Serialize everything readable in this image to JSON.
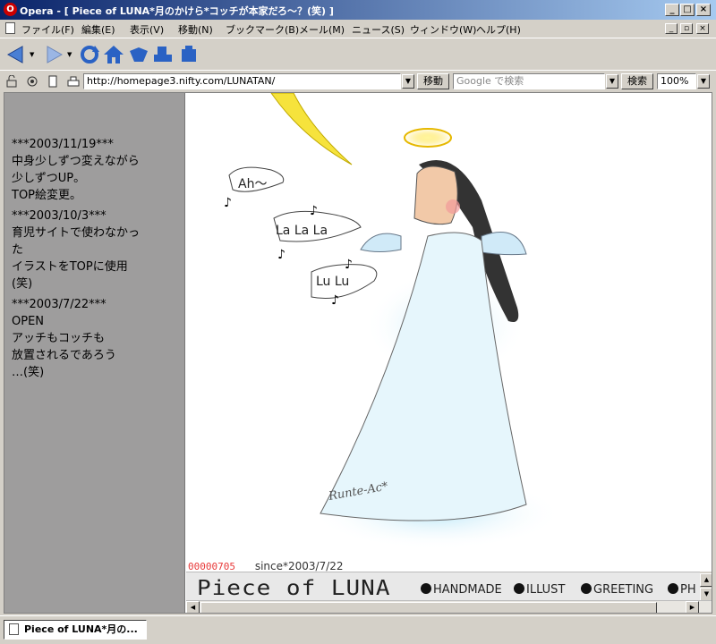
{
  "window": {
    "title": "Opera - [ Piece of LUNA*月のかけら*コッチが本家だろ～？(笑) ]",
    "controls": [
      "_",
      "□",
      "×"
    ]
  },
  "menubar": {
    "items": [
      "ファイル(F)",
      "編集(E)",
      "表示(V)",
      "移動(N)",
      "ブックマーク(B)",
      "メール(M)",
      "ニュース(S)",
      "ウィンドウ(W)",
      "ヘルプ(H)"
    ],
    "mdi_controls": [
      "_",
      "▫",
      "×"
    ]
  },
  "toolbar": {
    "buttons": [
      "back-icon",
      "forward-icon",
      "reload-icon",
      "home-icon",
      "bookmarks-icon",
      "print-icon"
    ]
  },
  "addressbar": {
    "url": "http://homepage3.nifty.com/LUNATAN/",
    "go_label": "移動",
    "search_placeholder": "Google で検索",
    "search_label": "検索",
    "zoom": "100%"
  },
  "sidebar": {
    "news": [
      {
        "date": "***2003/11/19***",
        "lines": [
          "中身少しずつ変えながら",
          "少しずつUP。",
          "TOP絵変更。"
        ]
      },
      {
        "date": "***2003/10/3***",
        "lines": [
          "育児サイトで使わなかっ",
          "た",
          "イラストをTOPに使用",
          "(笑)"
        ]
      },
      {
        "date": "***2003/7/22***",
        "lines": [
          "OPEN",
          "アッチもコッチも",
          "放置されるであろう",
          "…(笑)"
        ]
      }
    ]
  },
  "main": {
    "illustration": {
      "bubble1": "Ah～",
      "bubble2": "La La La",
      "bubble3": "Lu Lu",
      "signature": "Runte-Ac*"
    },
    "counter": "00000705",
    "since": "since*2003/7/22",
    "logo": "Piece of LUNA",
    "nav": [
      "HANDMADE",
      "ILLUST",
      "GREETING",
      "PH"
    ]
  },
  "tabs": {
    "items": [
      "Piece of LUNA*月の..."
    ]
  }
}
